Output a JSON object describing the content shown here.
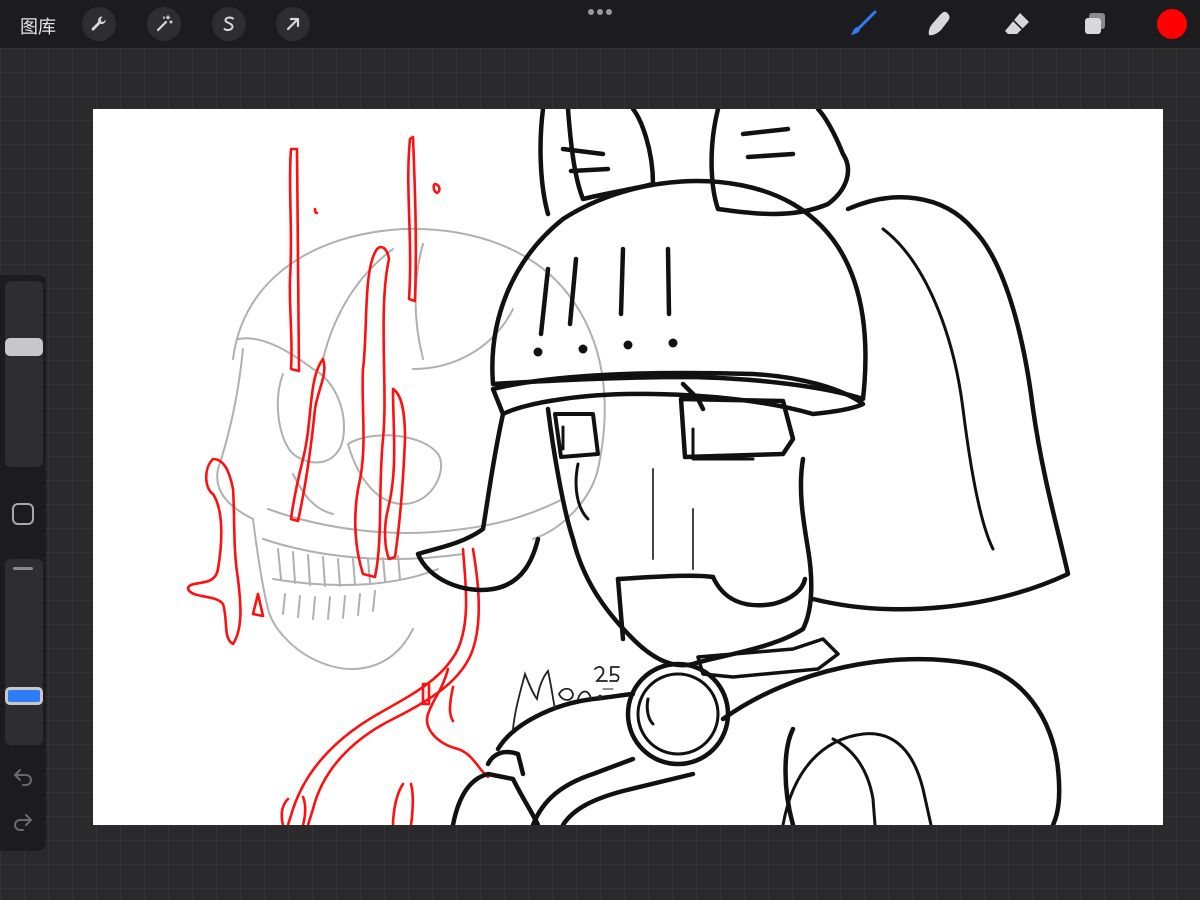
{
  "app": {
    "gallery_label": "图库"
  },
  "toolbar_left": [
    {
      "name": "actions-button",
      "icon": "wrench-icon"
    },
    {
      "name": "adjustments-button",
      "icon": "magic-wand-icon"
    },
    {
      "name": "selection-button",
      "icon": "selection-s-icon"
    },
    {
      "name": "transform-button",
      "icon": "arrow-cursor-icon"
    }
  ],
  "toolbar_right": [
    {
      "name": "brush-tool",
      "icon": "brush-icon",
      "active": true
    },
    {
      "name": "smudge-tool",
      "icon": "smudge-finger-icon"
    },
    {
      "name": "eraser-tool",
      "icon": "eraser-icon"
    },
    {
      "name": "layers-button",
      "icon": "layers-icon"
    }
  ],
  "colors": {
    "active_tool": "#2f7cf6",
    "current_color": "#ff0000",
    "blood": "#ff1010",
    "ink": "#111111"
  },
  "sidebar": {
    "brush_size_level": 0.66,
    "opacity_level": 0.24
  },
  "canvas": {
    "signature_text": "Mon 25"
  }
}
